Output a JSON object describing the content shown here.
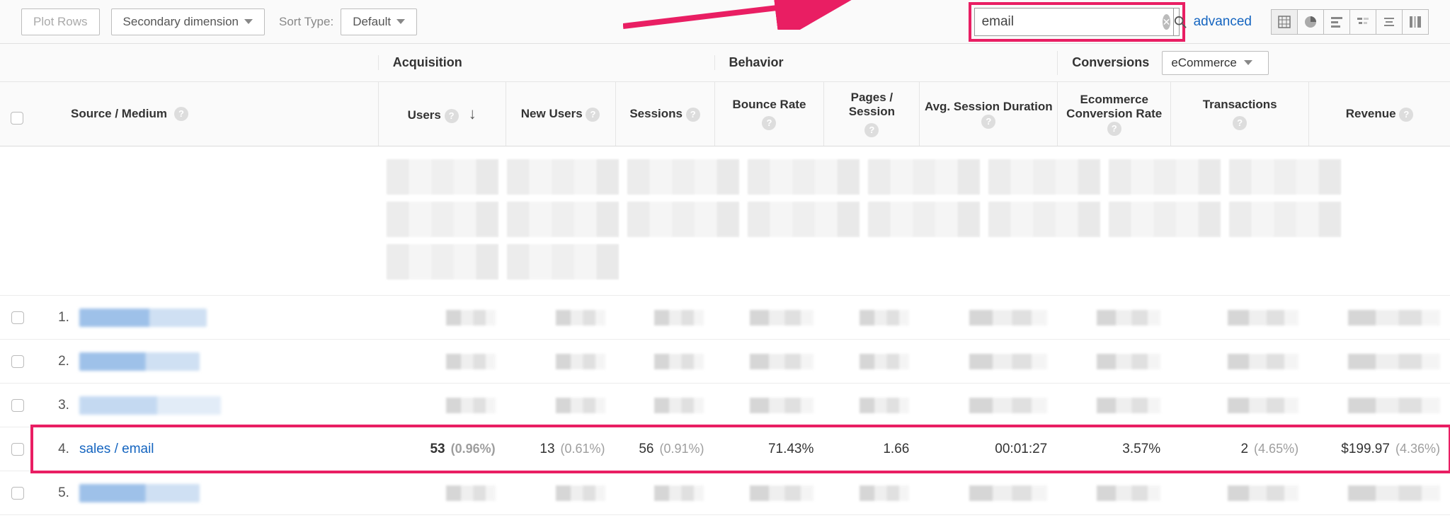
{
  "toolbar": {
    "plot_rows": "Plot Rows",
    "secondary_dim": "Secondary dimension",
    "sort_type_label": "Sort Type:",
    "sort_type_value": "Default",
    "search_value": "email",
    "advanced": "advanced"
  },
  "columns": {
    "primary": "Source / Medium",
    "group_acq": "Acquisition",
    "group_beh": "Behavior",
    "group_conv": "Conversions",
    "conv_select": "eCommerce",
    "users": "Users",
    "new_users": "New Users",
    "sessions": "Sessions",
    "bounce": "Bounce Rate",
    "pages": "Pages / Session",
    "duration": "Avg. Session Duration",
    "conv_rate": "Ecommerce Conversion Rate",
    "transactions": "Transactions",
    "revenue": "Revenue"
  },
  "rows": {
    "r1_idx": "1.",
    "r2_idx": "2.",
    "r3_idx": "3.",
    "r5_idx": "5.",
    "r4": {
      "idx": "4.",
      "name": "sales / email",
      "users": "53",
      "users_pct": "(0.96%)",
      "new": "13",
      "new_pct": "(0.61%)",
      "sess": "56",
      "sess_pct": "(0.91%)",
      "bounce": "71.43%",
      "pages": "1.66",
      "dur": "00:01:27",
      "conv": "3.57%",
      "trans": "2",
      "trans_pct": "(4.65%)",
      "rev": "$199.97",
      "rev_pct": "(4.36%)"
    }
  }
}
